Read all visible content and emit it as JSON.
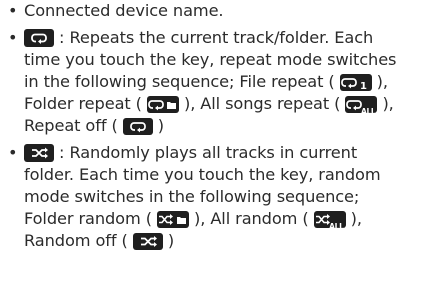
{
  "bullet": "•",
  "item1": {
    "text": "Connected device name."
  },
  "item2": {
    "line1_rest": " : Repeats the current track/folder. Each",
    "line2": "time you touch the key, repeat mode switches",
    "line3_a": "in the following sequence; File repeat ( ",
    "line3_b": " ),",
    "line4_a": "Folder repeat ( ",
    "line4_b": " ), All songs repeat ( ",
    "line4_c": " ),",
    "line5_a": "Repeat off ( ",
    "line5_b": " )",
    "icon_file_repeat_badge": "1",
    "icon_all_repeat_badge": "ALL"
  },
  "item3": {
    "line1_rest": " : Randomly plays all tracks in current",
    "line2": "folder. Each time you touch the key, random",
    "line3": "mode switches in the following sequence;",
    "line4_a": "Folder random ( ",
    "line4_b": " ), All random ( ",
    "line4_c": " ),",
    "line5_a": "Random off ( ",
    "line5_b": " )",
    "icon_all_random_badge": "ALL"
  },
  "icons": {
    "repeat": "repeat-icon",
    "shuffle": "shuffle-icon",
    "folder": "folder-icon"
  },
  "colors": {
    "text": "#2b2b2b",
    "key_background": "#1f1f1f",
    "key_foreground": "#ffffff"
  }
}
